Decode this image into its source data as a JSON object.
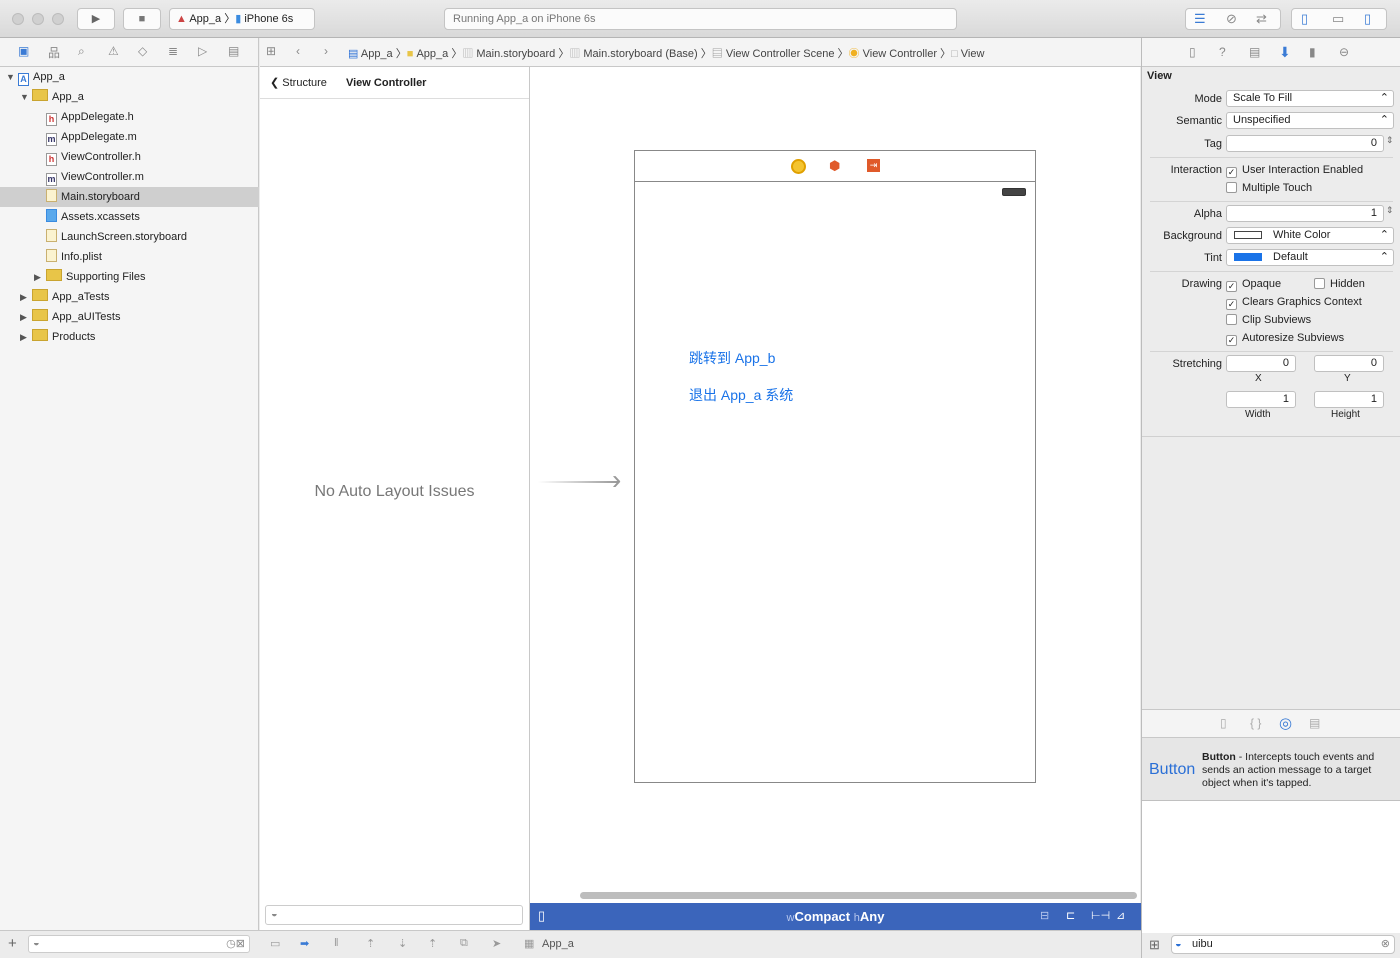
{
  "toolbar": {
    "scheme": "App_a",
    "device": "iPhone 6s",
    "status": "Running App_a on iPhone 6s"
  },
  "breadcrumb": [
    "App_a",
    "App_a",
    "Main.storyboard",
    "Main.storyboard (Base)",
    "View Controller Scene",
    "View Controller",
    "View"
  ],
  "navigator": {
    "items": [
      {
        "label": "App_a",
        "depth": 0,
        "kind": "project",
        "expanded": true
      },
      {
        "label": "App_a",
        "depth": 1,
        "kind": "folder",
        "expanded": true
      },
      {
        "label": "AppDelegate.h",
        "depth": 2,
        "kind": "h"
      },
      {
        "label": "AppDelegate.m",
        "depth": 2,
        "kind": "m"
      },
      {
        "label": "ViewController.h",
        "depth": 2,
        "kind": "h"
      },
      {
        "label": "ViewController.m",
        "depth": 2,
        "kind": "m"
      },
      {
        "label": "Main.storyboard",
        "depth": 2,
        "kind": "sb",
        "selected": true
      },
      {
        "label": "Assets.xcassets",
        "depth": 2,
        "kind": "assets"
      },
      {
        "label": "LaunchScreen.storyboard",
        "depth": 2,
        "kind": "sb"
      },
      {
        "label": "Info.plist",
        "depth": 2,
        "kind": "plist"
      },
      {
        "label": "Supporting Files",
        "depth": 2,
        "kind": "folder",
        "expanded": false
      },
      {
        "label": "App_aTests",
        "depth": 1,
        "kind": "folder",
        "expanded": false
      },
      {
        "label": "App_aUITests",
        "depth": 1,
        "kind": "folder",
        "expanded": false
      },
      {
        "label": "Products",
        "depth": 1,
        "kind": "folder",
        "expanded": false
      }
    ]
  },
  "outline": {
    "back": "Structure",
    "title": "View Controller",
    "message": "No Auto Layout Issues"
  },
  "canvas": {
    "button1": "跳转到  App_b",
    "button2": "退出 App_a 系统",
    "size_class_w": "w",
    "size_class_wv": "Compact",
    "size_class_h": "h",
    "size_class_hv": "Any"
  },
  "inspector": {
    "section": "View",
    "mode_label": "Mode",
    "mode": "Scale To Fill",
    "semantic_label": "Semantic",
    "semantic": "Unspecified",
    "tag_label": "Tag",
    "tag": "0",
    "interaction_label": "Interaction",
    "user_interaction": "User Interaction Enabled",
    "multiple_touch": "Multiple Touch",
    "alpha_label": "Alpha",
    "alpha": "1",
    "background_label": "Background",
    "background": "White Color",
    "tint_label": "Tint",
    "tint": "Default",
    "tint_color": "#1a73e8",
    "drawing_label": "Drawing",
    "opaque": "Opaque",
    "hidden": "Hidden",
    "clears": "Clears Graphics Context",
    "clip": "Clip Subviews",
    "autoresize": "Autoresize Subviews",
    "stretching_label": "Stretching",
    "sx": "0",
    "sy": "0",
    "sw": "1",
    "sh": "1",
    "x_label": "X",
    "y_label": "Y",
    "w_label": "Width",
    "h_label": "Height"
  },
  "library": {
    "preview": "Button",
    "name": "Button",
    "desc": " - Intercepts touch events and sends an action message to a target object when it's tapped.",
    "search": "uibu"
  },
  "debug": {
    "target": "App_a"
  }
}
